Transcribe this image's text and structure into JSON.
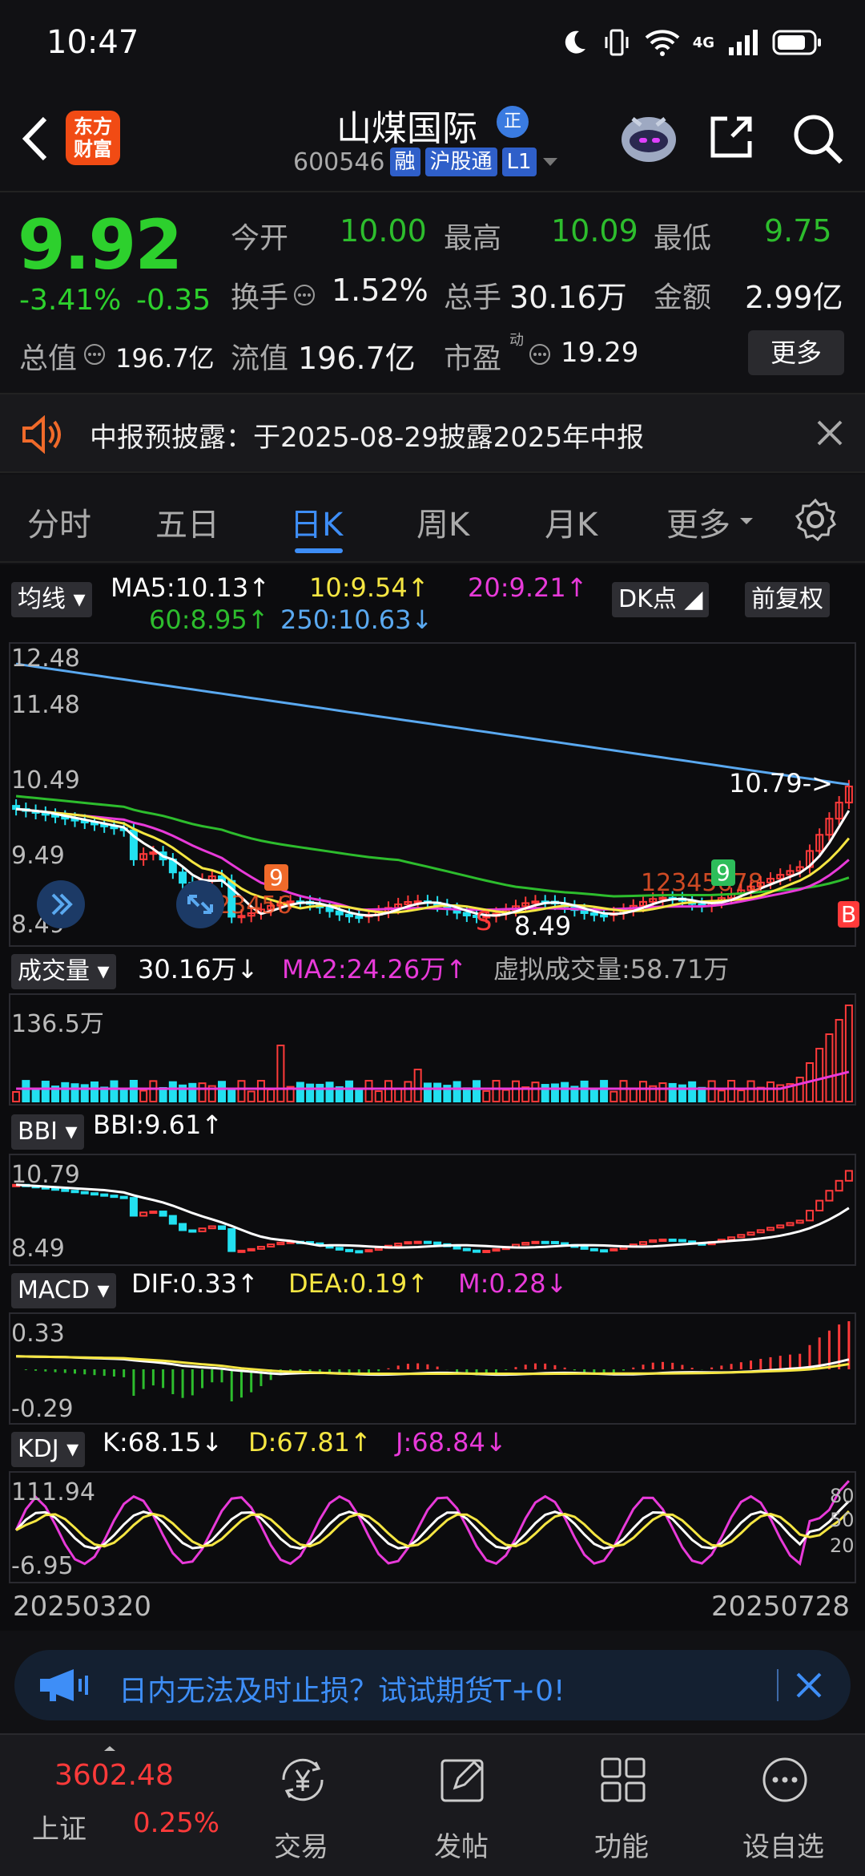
{
  "status": {
    "time": "10:47",
    "network": "4G"
  },
  "header": {
    "logo_text_1": "东方",
    "logo_text_2": "财富",
    "name": "山煤国际",
    "name_badge": "正",
    "code": "600546",
    "tags": [
      "融",
      "沪股通",
      "L1"
    ]
  },
  "quote": {
    "price": "9.92",
    "change_pct": "-3.41%",
    "change_abs": "-0.35",
    "fields": {
      "open_label": "今开",
      "open": "10.00",
      "high_label": "最高",
      "high": "10.09",
      "low_label": "最低",
      "low": "9.75",
      "turnover_label": "换手",
      "turnover": "1.52%",
      "volume_label": "总手",
      "volume": "30.16万",
      "amount_label": "金额",
      "amount": "2.99亿",
      "total_cap_label": "总值",
      "total_cap": "196.7亿",
      "float_cap_label": "流值",
      "float_cap": "196.7亿",
      "pe_label": "市盈",
      "pe_sup": "动",
      "pe": "19.29"
    },
    "more_label": "更多"
  },
  "notice": {
    "text": "中报预披露：于2025-08-29披露2025年中报"
  },
  "tabs": [
    {
      "label": "分时"
    },
    {
      "label": "五日"
    },
    {
      "label": "日K"
    },
    {
      "label": "周K"
    },
    {
      "label": "月K"
    },
    {
      "label": "更多"
    }
  ],
  "kline": {
    "ma_button": "均线",
    "ma5": "MA5:10.13↑",
    "ma10": "10:9.54↑",
    "ma20": "20:9.21↑",
    "ma60": "60:8.95↑",
    "ma250": "250:10.63↓",
    "dk_button": "DK点",
    "adjust_button": "前复权",
    "y_ticks": [
      "12.48",
      "11.48",
      "10.49",
      "9.49",
      "8.49"
    ],
    "high_marker": "10.79->",
    "low_marker": "8.49",
    "signal_s": "S",
    "signal_b": "B",
    "seq_left": "123456",
    "seq_right": "12345678",
    "seq_nine": "9",
    "colors": {
      "ma5": "#ffffff",
      "ma10": "#f5e642",
      "ma20": "#e83ad9",
      "ma60": "#2dbd2d",
      "ma250": "#5aa9f0",
      "up": "#ff3a3a",
      "down": "#22e0f0"
    }
  },
  "volume": {
    "button": "成交量",
    "value": "30.16万↓",
    "ma2": "MA2:24.26万↑",
    "virtual": "虚拟成交量:58.71万",
    "y_top": "136.5万"
  },
  "bbi": {
    "button": "BBI",
    "value": "BBI:9.61↑",
    "y_top": "10.79",
    "y_bottom": "8.49"
  },
  "macd": {
    "button": "MACD",
    "dif": "DIF:0.33↑",
    "dea": "DEA:0.19↑",
    "m": "M:0.28↓",
    "y_top": "0.33",
    "y_bottom": "-0.29"
  },
  "kdj": {
    "button": "KDJ",
    "k": "K:68.15↓",
    "d": "D:67.81↑",
    "j": "J:68.84↓",
    "y_top": "111.94",
    "y_bottom": "-6.95",
    "r80": "80",
    "r50": "50",
    "r20": "20"
  },
  "dates": {
    "start": "20250320",
    "end": "20250728"
  },
  "ad": {
    "text": "日内无法及时止损？试试期货T+0!"
  },
  "bottom_nav": {
    "index_value": "3602.48",
    "index_name": "上证",
    "index_change": "0.25%",
    "items": [
      {
        "label": "交易"
      },
      {
        "label": "发帖"
      },
      {
        "label": "功能"
      },
      {
        "label": "设自选"
      }
    ]
  }
}
